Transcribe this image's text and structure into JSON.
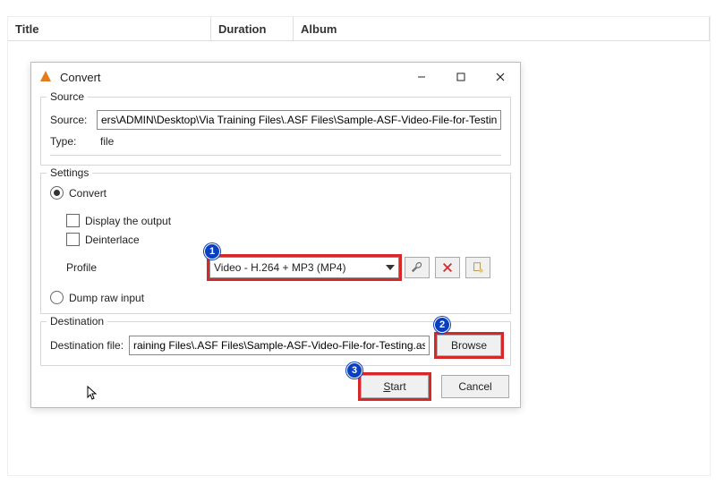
{
  "table_headers": {
    "title": "Title",
    "duration": "Duration",
    "album": "Album"
  },
  "dialog": {
    "title": "Convert",
    "source_group": "Source",
    "source_label": "Source:",
    "source_value": "ers\\ADMIN\\Desktop\\Via Training Files\\.ASF Files\\Sample-ASF-Video-File-for-Testing.asf",
    "type_label": "Type:",
    "type_value": "file",
    "settings_group": "Settings",
    "convert_radio": "Convert",
    "display_output": "Display the output",
    "deinterlace": "Deinterlace",
    "profile_label": "Profile",
    "profile_value": "Video - H.264 + MP3 (MP4)",
    "dump_raw": "Dump raw input",
    "dest_group": "Destination",
    "dest_label": "Destination file:",
    "dest_value": "raining Files\\.ASF Files\\Sample-ASF-Video-File-for-Testing.asf",
    "browse": "Browse",
    "start_key": "S",
    "start_rest": "tart",
    "cancel": "Cancel"
  },
  "callouts": {
    "one": "1",
    "two": "2",
    "three": "3"
  }
}
